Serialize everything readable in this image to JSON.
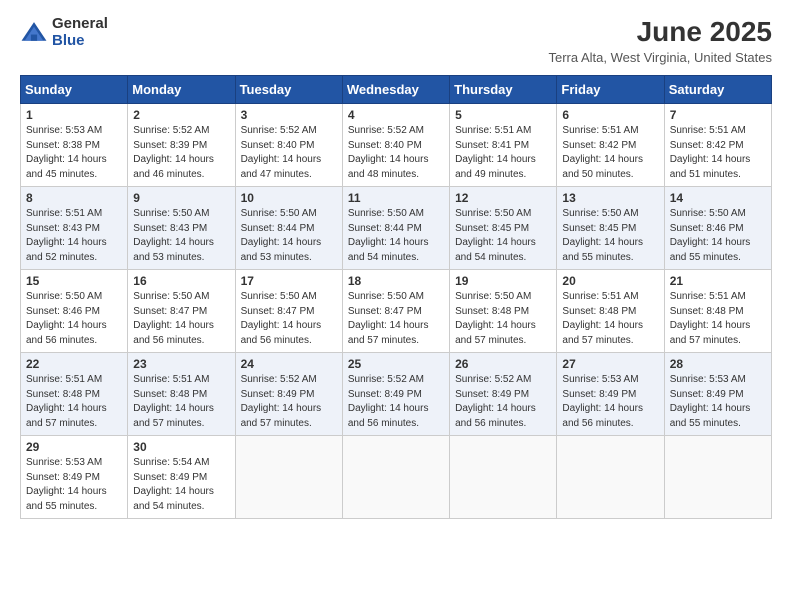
{
  "logo": {
    "general": "General",
    "blue": "Blue"
  },
  "title": "June 2025",
  "subtitle": "Terra Alta, West Virginia, United States",
  "days_of_week": [
    "Sunday",
    "Monday",
    "Tuesday",
    "Wednesday",
    "Thursday",
    "Friday",
    "Saturday"
  ],
  "weeks": [
    [
      {
        "day": 1,
        "sunrise": "5:53 AM",
        "sunset": "8:38 PM",
        "daylight": "14 hours and 45 minutes."
      },
      {
        "day": 2,
        "sunrise": "5:52 AM",
        "sunset": "8:39 PM",
        "daylight": "14 hours and 46 minutes."
      },
      {
        "day": 3,
        "sunrise": "5:52 AM",
        "sunset": "8:40 PM",
        "daylight": "14 hours and 47 minutes."
      },
      {
        "day": 4,
        "sunrise": "5:52 AM",
        "sunset": "8:40 PM",
        "daylight": "14 hours and 48 minutes."
      },
      {
        "day": 5,
        "sunrise": "5:51 AM",
        "sunset": "8:41 PM",
        "daylight": "14 hours and 49 minutes."
      },
      {
        "day": 6,
        "sunrise": "5:51 AM",
        "sunset": "8:42 PM",
        "daylight": "14 hours and 50 minutes."
      },
      {
        "day": 7,
        "sunrise": "5:51 AM",
        "sunset": "8:42 PM",
        "daylight": "14 hours and 51 minutes."
      }
    ],
    [
      {
        "day": 8,
        "sunrise": "5:51 AM",
        "sunset": "8:43 PM",
        "daylight": "14 hours and 52 minutes."
      },
      {
        "day": 9,
        "sunrise": "5:50 AM",
        "sunset": "8:43 PM",
        "daylight": "14 hours and 53 minutes."
      },
      {
        "day": 10,
        "sunrise": "5:50 AM",
        "sunset": "8:44 PM",
        "daylight": "14 hours and 53 minutes."
      },
      {
        "day": 11,
        "sunrise": "5:50 AM",
        "sunset": "8:44 PM",
        "daylight": "14 hours and 54 minutes."
      },
      {
        "day": 12,
        "sunrise": "5:50 AM",
        "sunset": "8:45 PM",
        "daylight": "14 hours and 54 minutes."
      },
      {
        "day": 13,
        "sunrise": "5:50 AM",
        "sunset": "8:45 PM",
        "daylight": "14 hours and 55 minutes."
      },
      {
        "day": 14,
        "sunrise": "5:50 AM",
        "sunset": "8:46 PM",
        "daylight": "14 hours and 55 minutes."
      }
    ],
    [
      {
        "day": 15,
        "sunrise": "5:50 AM",
        "sunset": "8:46 PM",
        "daylight": "14 hours and 56 minutes."
      },
      {
        "day": 16,
        "sunrise": "5:50 AM",
        "sunset": "8:47 PM",
        "daylight": "14 hours and 56 minutes."
      },
      {
        "day": 17,
        "sunrise": "5:50 AM",
        "sunset": "8:47 PM",
        "daylight": "14 hours and 56 minutes."
      },
      {
        "day": 18,
        "sunrise": "5:50 AM",
        "sunset": "8:47 PM",
        "daylight": "14 hours and 57 minutes."
      },
      {
        "day": 19,
        "sunrise": "5:50 AM",
        "sunset": "8:48 PM",
        "daylight": "14 hours and 57 minutes."
      },
      {
        "day": 20,
        "sunrise": "5:51 AM",
        "sunset": "8:48 PM",
        "daylight": "14 hours and 57 minutes."
      },
      {
        "day": 21,
        "sunrise": "5:51 AM",
        "sunset": "8:48 PM",
        "daylight": "14 hours and 57 minutes."
      }
    ],
    [
      {
        "day": 22,
        "sunrise": "5:51 AM",
        "sunset": "8:48 PM",
        "daylight": "14 hours and 57 minutes."
      },
      {
        "day": 23,
        "sunrise": "5:51 AM",
        "sunset": "8:48 PM",
        "daylight": "14 hours and 57 minutes."
      },
      {
        "day": 24,
        "sunrise": "5:52 AM",
        "sunset": "8:49 PM",
        "daylight": "14 hours and 57 minutes."
      },
      {
        "day": 25,
        "sunrise": "5:52 AM",
        "sunset": "8:49 PM",
        "daylight": "14 hours and 56 minutes."
      },
      {
        "day": 26,
        "sunrise": "5:52 AM",
        "sunset": "8:49 PM",
        "daylight": "14 hours and 56 minutes."
      },
      {
        "day": 27,
        "sunrise": "5:53 AM",
        "sunset": "8:49 PM",
        "daylight": "14 hours and 56 minutes."
      },
      {
        "day": 28,
        "sunrise": "5:53 AM",
        "sunset": "8:49 PM",
        "daylight": "14 hours and 55 minutes."
      }
    ],
    [
      {
        "day": 29,
        "sunrise": "5:53 AM",
        "sunset": "8:49 PM",
        "daylight": "14 hours and 55 minutes."
      },
      {
        "day": 30,
        "sunrise": "5:54 AM",
        "sunset": "8:49 PM",
        "daylight": "14 hours and 54 minutes."
      },
      null,
      null,
      null,
      null,
      null
    ]
  ]
}
